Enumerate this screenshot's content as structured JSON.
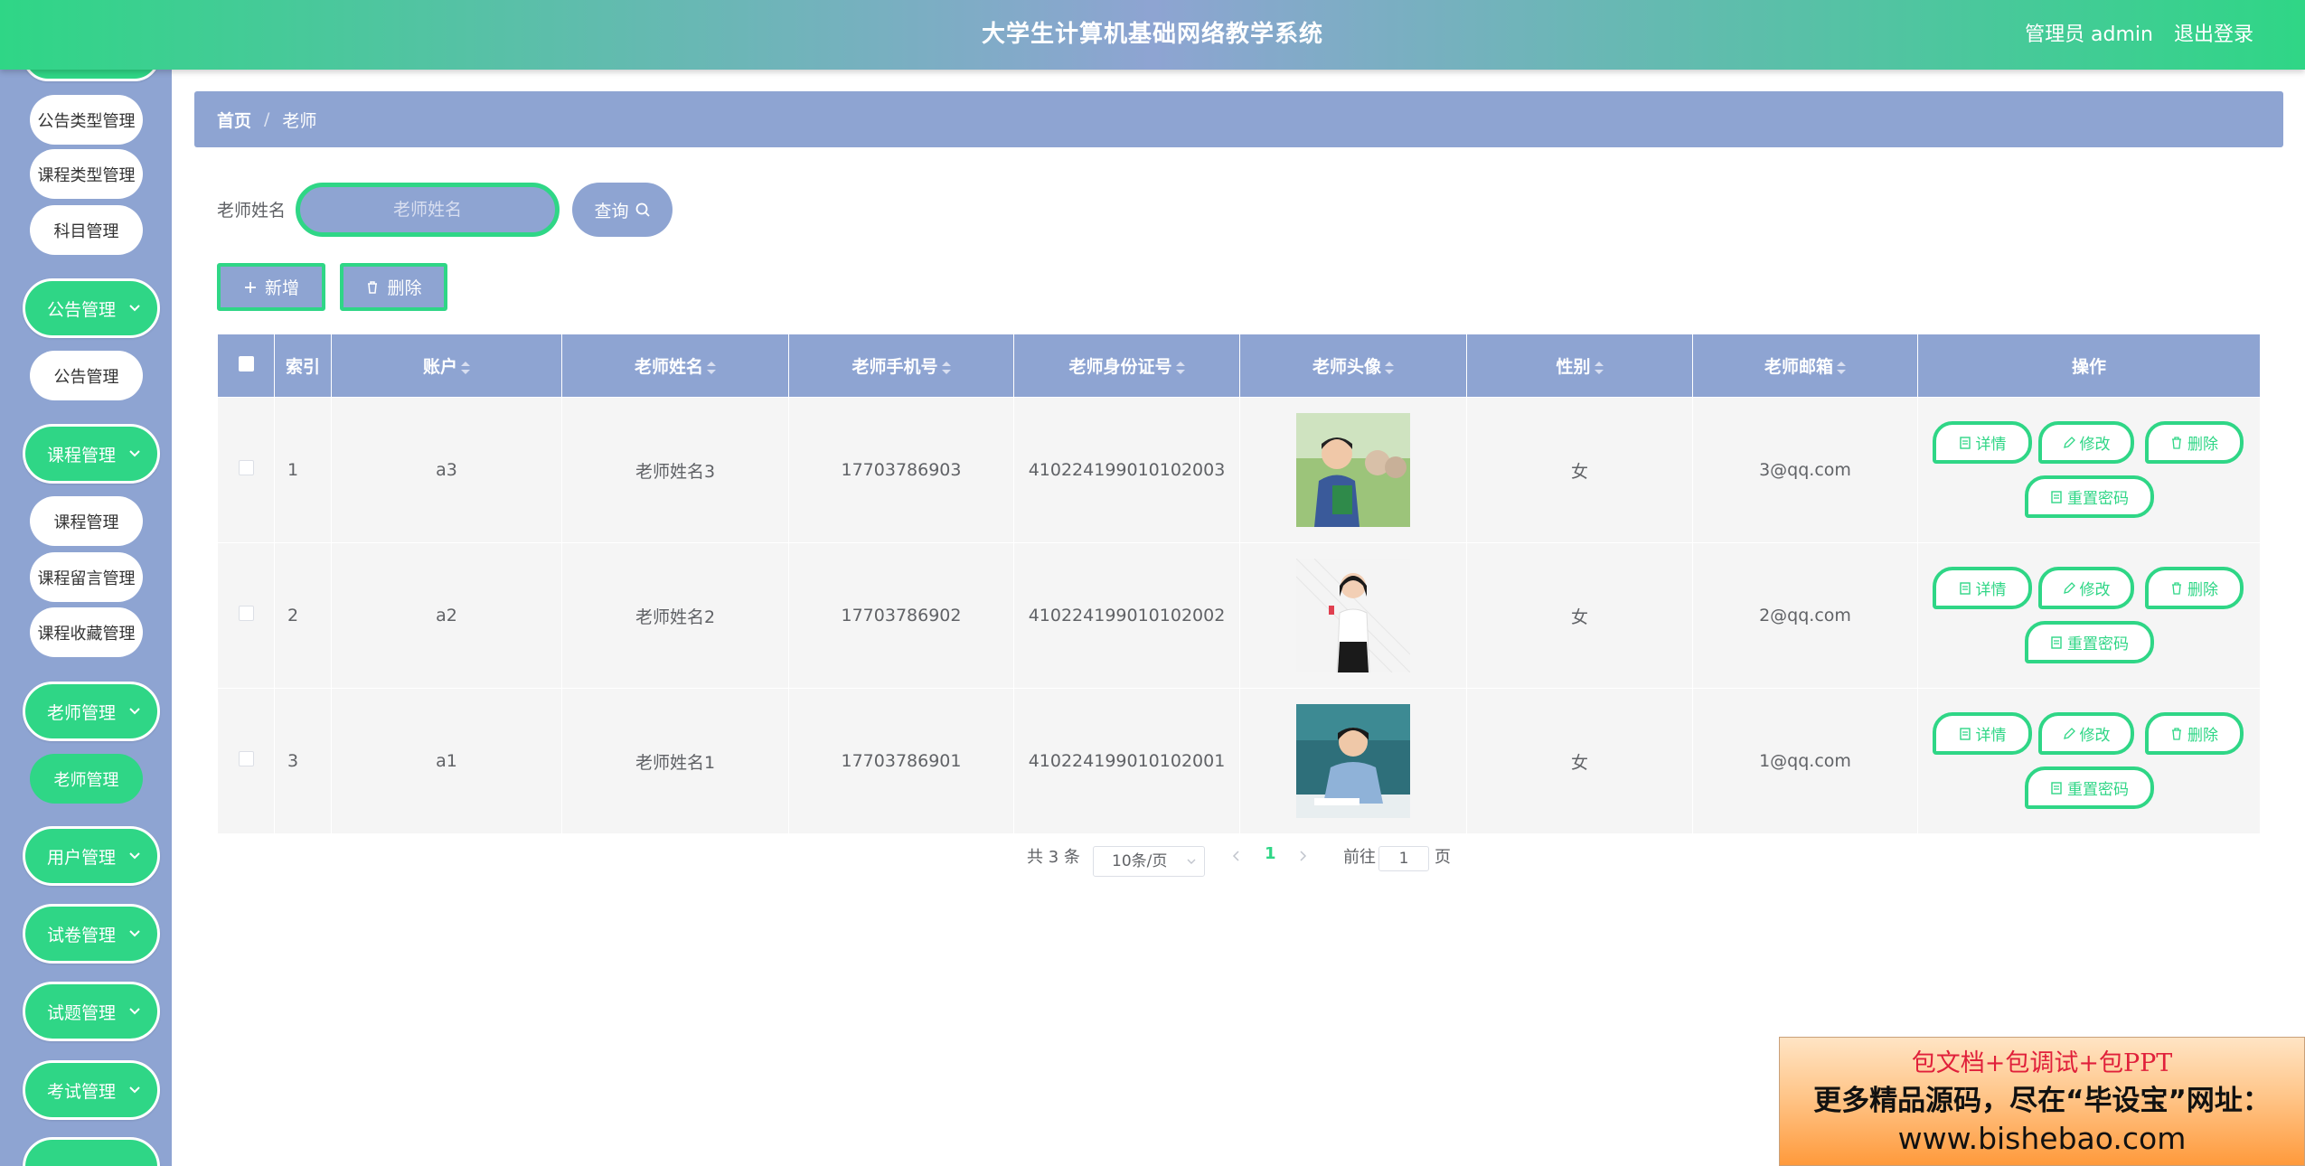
{
  "header": {
    "title": "大学生计算机基础网络教学系统",
    "user": "管理员 admin",
    "logout": "退出登录"
  },
  "sidebar": {
    "children_top": [
      "公告类型管理",
      "课程类型管理",
      "科目管理"
    ],
    "notice": {
      "label": "公告管理",
      "children": [
        "公告管理"
      ]
    },
    "course": {
      "label": "课程管理",
      "children": [
        "课程管理",
        "课程留言管理",
        "课程收藏管理"
      ]
    },
    "teacher": {
      "label": "老师管理",
      "children": [
        "老师管理"
      ]
    },
    "user": {
      "label": "用户管理"
    },
    "paper": {
      "label": "试卷管理"
    },
    "question": {
      "label": "试题管理"
    },
    "exam": {
      "label": "考试管理"
    }
  },
  "breadcrumb": {
    "home": "首页",
    "sep": "/",
    "current": "老师"
  },
  "search": {
    "label": "老师姓名",
    "placeholder": "老师姓名",
    "button": "查询"
  },
  "toolbar": {
    "add": "新增",
    "delete": "删除"
  },
  "table": {
    "headers": [
      "索引",
      "账户",
      "老师姓名",
      "老师手机号",
      "老师身份证号",
      "老师头像",
      "性别",
      "老师邮箱",
      "操作"
    ],
    "rows": [
      {
        "index": "1",
        "account": "a3",
        "name": "老师姓名3",
        "phone": "17703786903",
        "idcard": "410224199010102003",
        "avatar": "teacher-photo-1",
        "gender": "女",
        "email": "3@qq.com"
      },
      {
        "index": "2",
        "account": "a2",
        "name": "老师姓名2",
        "phone": "17703786902",
        "idcard": "410224199010102002",
        "avatar": "teacher-photo-2",
        "gender": "女",
        "email": "2@qq.com"
      },
      {
        "index": "3",
        "account": "a1",
        "name": "老师姓名1",
        "phone": "17703786901",
        "idcard": "410224199010102001",
        "avatar": "teacher-photo-3",
        "gender": "女",
        "email": "1@qq.com"
      }
    ],
    "actions": {
      "detail": "详情",
      "edit": "修改",
      "delete": "删除",
      "reset": "重置密码"
    }
  },
  "pagination": {
    "total": "共 3 条",
    "page_size": "10条/页",
    "current": "1",
    "goto_prefix": "前往",
    "goto_value": "1",
    "goto_suffix": "页"
  },
  "ad": {
    "line1": "包文档+包调试+包PPT",
    "line2": "更多精品源码，尽在“毕设宝”网址：",
    "line3": "www.bishebao.com"
  },
  "colors": {
    "primary": "#2fd686",
    "secondary": "#8ea4d2",
    "row_bg": "#f5f5f5"
  }
}
